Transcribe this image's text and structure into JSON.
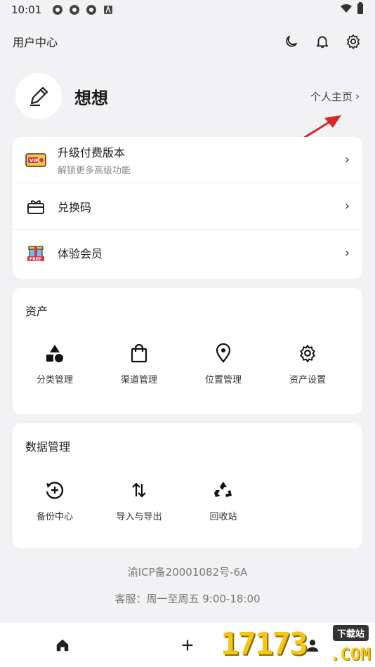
{
  "status_bar": {
    "time": "10:01"
  },
  "header": {
    "title": "用户中心"
  },
  "profile": {
    "name": "想想",
    "homepage_link": "个人主页"
  },
  "list": [
    {
      "label": "升级付费版本",
      "sub": "解锁更多高级功能"
    },
    {
      "label": "兑换码",
      "sub": ""
    },
    {
      "label": "体验会员",
      "sub": ""
    }
  ],
  "assets": {
    "title": "资产",
    "items": [
      {
        "label": "分类管理",
        "icon": "shapes-icon"
      },
      {
        "label": "渠道管理",
        "icon": "shopping-bag-icon"
      },
      {
        "label": "位置管理",
        "icon": "location-pin-icon"
      },
      {
        "label": "资产设置",
        "icon": "gear-icon"
      }
    ]
  },
  "data_management": {
    "title": "数据管理",
    "items": [
      {
        "label": "备份中心",
        "icon": "backup-icon"
      },
      {
        "label": "导入与导出",
        "icon": "import-export-icon"
      },
      {
        "label": "回收站",
        "icon": "recycle-icon"
      }
    ]
  },
  "footer": {
    "icp": "渝ICP备20001082号-6A",
    "service": "客服：周一至周五 9:00-18:00"
  },
  "watermark": {
    "number": "17173",
    "badge": "下载站",
    "domain": ".COM"
  }
}
